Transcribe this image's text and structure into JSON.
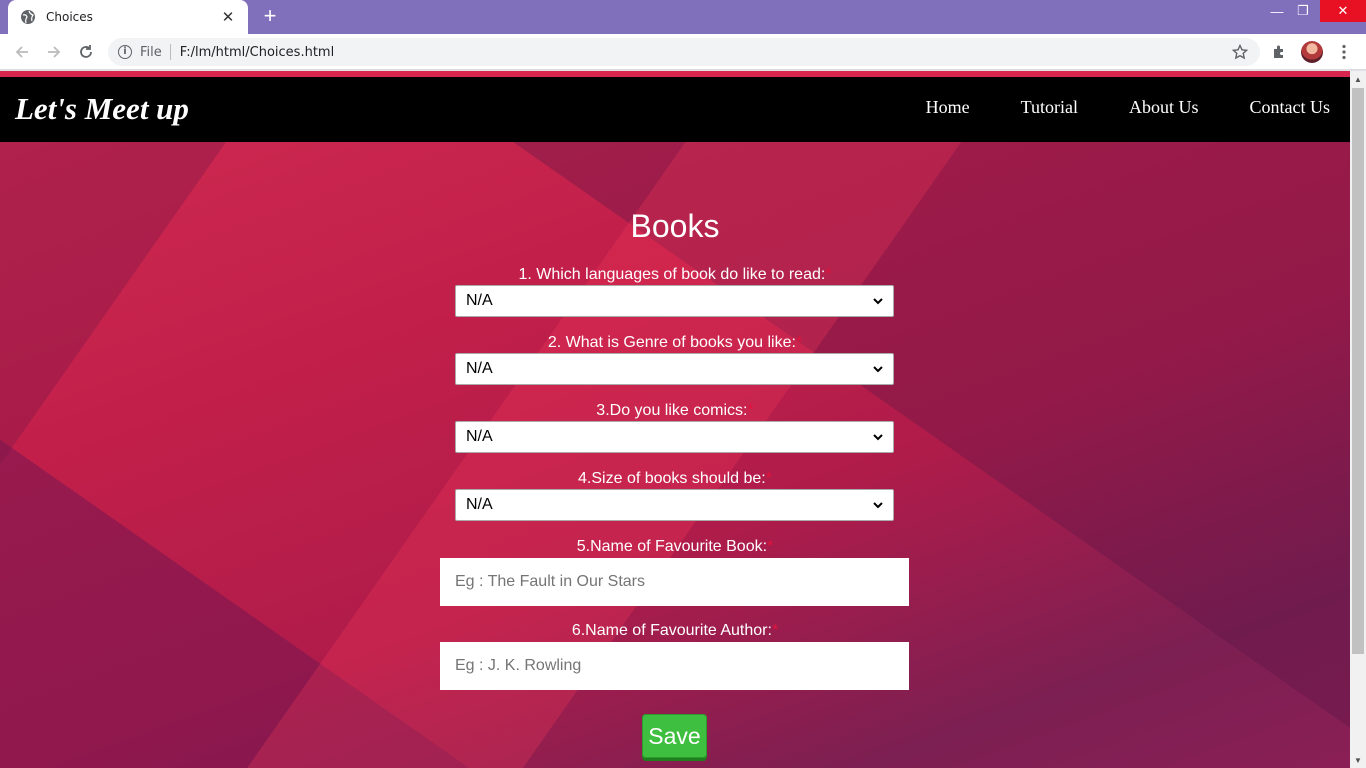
{
  "browser": {
    "tab_title": "Choices",
    "new_tab": "+",
    "url_scheme": "File",
    "url": "F:/lm/html/Choices.html",
    "window_controls": {
      "minimize": "—",
      "maximize": "❐",
      "close": "✕"
    }
  },
  "site": {
    "logo": "Let's Meet up",
    "nav": [
      "Home",
      "Tutorial",
      "About Us",
      "Contact Us"
    ]
  },
  "form": {
    "title": "Books",
    "required_mark": "*",
    "questions": [
      {
        "label": "1. Which languages of book do like to read:",
        "type": "select",
        "value": "N/A"
      },
      {
        "label": "2. What is Genre of books you like:",
        "type": "select",
        "value": "N/A"
      },
      {
        "label": "3.Do you like comics:",
        "type": "select",
        "value": "N/A"
      },
      {
        "label": "4.Size of books should be:",
        "type": "select",
        "value": "N/A"
      },
      {
        "label": "5.Name of Favourite Book:",
        "type": "text",
        "placeholder": "Eg : The Fault in Our Stars"
      },
      {
        "label": "6.Name of Favourite Author:",
        "type": "text",
        "placeholder": "Eg : J. K. Rowling"
      }
    ],
    "save_label": "Save"
  },
  "colors": {
    "tabstrip": "#8070bc",
    "header": "#000000",
    "accent": "#d9264f",
    "save": "#3fbf3f"
  }
}
